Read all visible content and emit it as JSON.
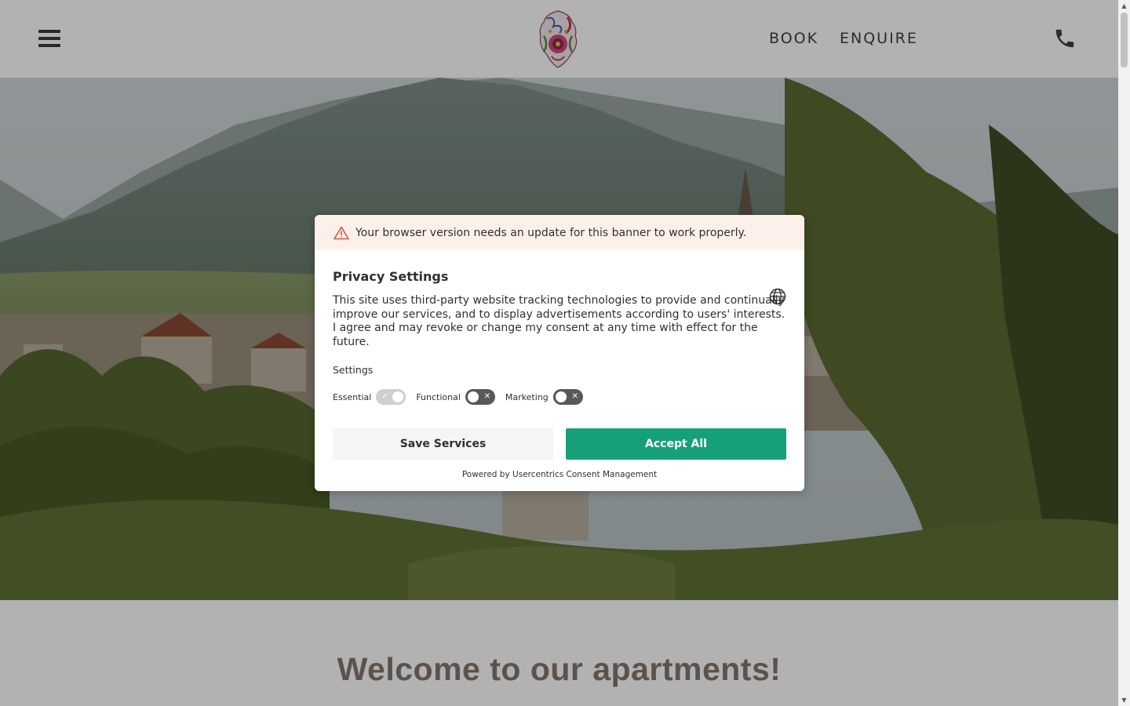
{
  "header": {
    "nav_book": "BOOK",
    "nav_enquire": "ENQUIRE",
    "icons": {
      "menu": "hamburger-menu-icon",
      "logo": "coat-of-arms-logo",
      "phone": "phone-icon"
    }
  },
  "welcome": {
    "title": "Welcome to our apartments!"
  },
  "consent": {
    "warning": "Your browser version needs an update for this banner to work properly.",
    "title": "Privacy Settings",
    "description": "This site uses third-party website tracking technologies to provide and continually improve our services, and to display advertisements according to users' interests. I agree and may revoke or change my consent at any time with effect for the future.",
    "settings_label": "Settings",
    "toggles": [
      {
        "label": "Essential",
        "state": "on",
        "locked": true
      },
      {
        "label": "Functional",
        "state": "off",
        "locked": false
      },
      {
        "label": "Marketing",
        "state": "off",
        "locked": false
      }
    ],
    "save_label": "Save Services",
    "accept_label": "Accept All",
    "powered_by": "Powered by Usercentrics Consent Management",
    "colors": {
      "accept_bg": "#16a07a",
      "warning_bg": "#fdf0ea",
      "warning_icon": "#d9534f"
    }
  }
}
